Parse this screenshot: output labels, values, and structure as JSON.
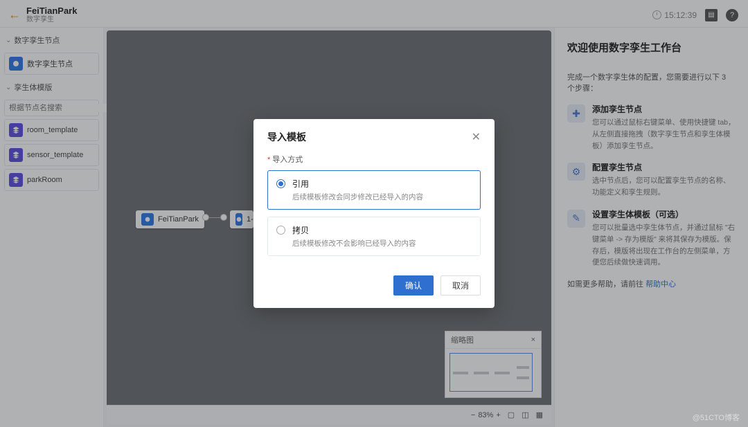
{
  "header": {
    "title": "FeiTianPark",
    "subtitle": "数字孪生",
    "time": "15:12:39"
  },
  "sidebar": {
    "section1_label": "数字孪生节点",
    "twin_node_label": "数字孪生节点",
    "section2_label": "孪生体模版",
    "search_placeholder": "根据节点名搜索",
    "templates": [
      {
        "label": "room_template"
      },
      {
        "label": "sensor_template"
      },
      {
        "label": "parkRoom"
      }
    ]
  },
  "canvas": {
    "node1_label": "FeiTianPark",
    "node2_label": "1-",
    "zoom": "83%",
    "minimap_title": "缩略图"
  },
  "rightPanel": {
    "welcome": "欢迎使用数字孪生工作台",
    "intro": "完成一个数字孪生体的配置，您需要进行以下 3 个步骤：",
    "steps": [
      {
        "title": "添加孪生节点",
        "desc": "您可以通过鼠标右键菜单、使用快捷键 tab，从左侧直接拖拽（数字孪生节点和孪生体模板）添加孪生节点。"
      },
      {
        "title": "配置孪生节点",
        "desc": "选中节点后，您可以配置孪生节点的名称、功能定义和孪生规则。"
      },
      {
        "title": "设置孪生体模板（可选）",
        "desc": "您可以批量选中孪生体节点，并通过鼠标 \"右键菜单 -> 存为模版\" 来将其保存为模版。保存后，模版将出现在工作台的左侧菜单，方便您后续做快速调用。"
      }
    ],
    "help_prefix": "如需更多帮助，请前往 ",
    "help_link": "帮助中心"
  },
  "modal": {
    "title": "导入模板",
    "field_label": "导入方式",
    "options": [
      {
        "title": "引用",
        "desc": "后续模板修改会同步修改已经导入的内容"
      },
      {
        "title": "拷贝",
        "desc": "后续模板修改不会影响已经导入的内容"
      }
    ],
    "confirm": "确认",
    "cancel": "取消"
  },
  "watermark": "@51CTO博客"
}
